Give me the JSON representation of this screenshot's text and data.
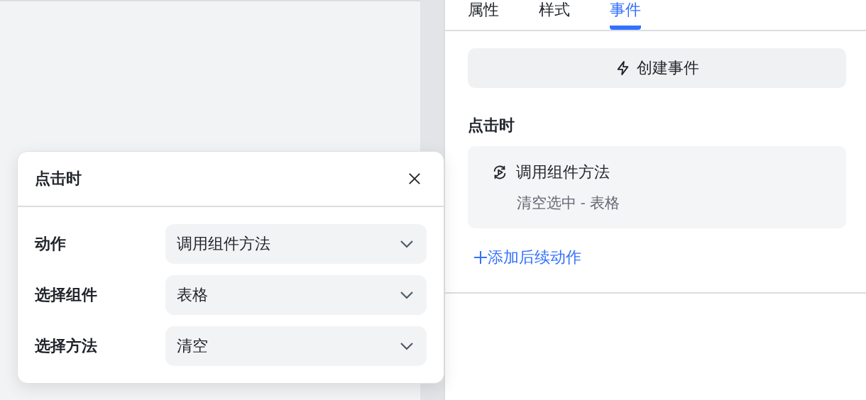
{
  "tabs": [
    {
      "label": "属性",
      "selected": false
    },
    {
      "label": "样式",
      "selected": false
    },
    {
      "label": "事件",
      "selected": true
    }
  ],
  "create_button": {
    "label": "创建事件"
  },
  "event_section": {
    "title": "点击时",
    "actions": [
      {
        "title": "调用组件方法",
        "detail": "清空选中 - 表格"
      }
    ],
    "add_link": "添加后续动作"
  },
  "popup": {
    "title": "点击时",
    "fields": [
      {
        "label": "动作",
        "value": "调用组件方法"
      },
      {
        "label": "选择组件",
        "value": "表格"
      },
      {
        "label": "选择方法",
        "value": "清空"
      }
    ]
  }
}
